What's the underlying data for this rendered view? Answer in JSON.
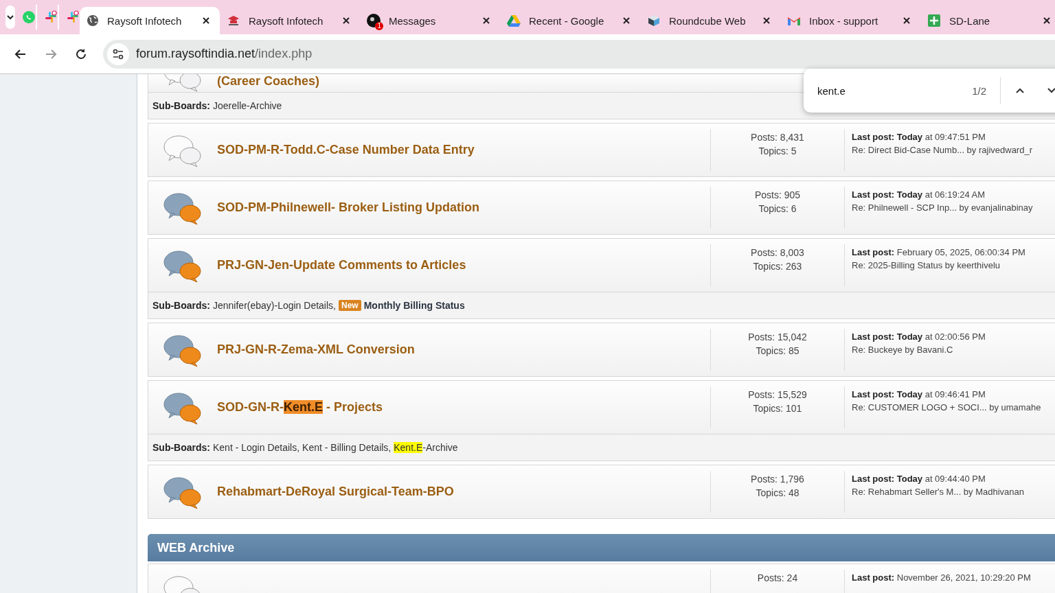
{
  "tabs": [
    {
      "kind": "pinned",
      "selected": false
    },
    {
      "kind": "pinned",
      "selected": false
    },
    {
      "kind": "pinned",
      "selected": false
    },
    {
      "kind": "tab",
      "title": "Raysoft Infotech",
      "selected": true
    },
    {
      "kind": "tab",
      "title": "Raysoft Infotech",
      "selected": false
    },
    {
      "kind": "tab",
      "title": "Messages",
      "badge": "1",
      "selected": false
    },
    {
      "kind": "tab",
      "title": "Recent - Google",
      "selected": false
    },
    {
      "kind": "tab",
      "title": "Roundcube Web",
      "selected": false
    },
    {
      "kind": "tab",
      "title": "Inbox - support",
      "selected": false
    },
    {
      "kind": "tab",
      "title": "SD-Lane",
      "selected": false
    }
  ],
  "address": {
    "host": "forum.raysoftindia.net",
    "path": "/index.php"
  },
  "find_bar": {
    "query": "kent.e",
    "count": "1/2"
  },
  "sections": [
    {
      "kind": "board_partial",
      "unread": false,
      "title": [
        {
          "text": "(Career Coaches)"
        }
      ]
    },
    {
      "kind": "subboards",
      "label": "Sub-Boards:",
      "items": [
        {
          "parts": [
            {
              "text": "Joerelle-Archive"
            }
          ]
        }
      ]
    },
    {
      "kind": "board",
      "unread": false,
      "title": [
        {
          "text": "SOD-PM-R-Todd.C-Case Number Data Entry"
        }
      ],
      "posts": "Posts: 8,431",
      "topics": "Topics: 5",
      "last_post": "**Last post: Today** at 09:47:51 PM",
      "last_reply": "Re: Direct Bid-Case Numb... by rajivedward_r"
    },
    {
      "kind": "board",
      "unread": true,
      "title": [
        {
          "text": "SOD-PM-Philnewell- Broker Listing Updation"
        }
      ],
      "posts": "Posts: 905",
      "topics": "Topics: 6",
      "last_post": "**Last post: Today** at 06:19:24 AM",
      "last_reply": "Re: Philnewell - SCP Inp... by evanjalinabinay"
    },
    {
      "kind": "board",
      "unread": true,
      "title": [
        {
          "text": "PRJ-GN-Jen-Update Comments to Articles"
        }
      ],
      "posts": "Posts: 8,003",
      "topics": "Topics: 263",
      "last_post": "**Last post:** February 05, 2025, 06:00:34 PM",
      "last_reply": "Re: 2025-Billing Status by keerthivelu"
    },
    {
      "kind": "subboards",
      "label": "Sub-Boards:",
      "items": [
        {
          "parts": [
            {
              "text": "Jennifer(ebay)-Login Details,"
            }
          ]
        },
        {
          "badge": "New",
          "unread": true,
          "parts": [
            {
              "text": "Monthly Billing Status"
            }
          ]
        }
      ]
    },
    {
      "kind": "board",
      "unread": true,
      "title": [
        {
          "text": "PRJ-GN-R-Zema-XML Conversion"
        }
      ],
      "posts": "Posts: 15,042",
      "topics": "Topics: 85",
      "last_post": "**Last post: Today** at 02:00:56 PM",
      "last_reply": "Re: Buckeye by Bavani.C"
    },
    {
      "kind": "board",
      "unread": true,
      "title": [
        {
          "text": "SOD-GN-R-",
          "highlighted": false
        },
        {
          "text": "Kent.E",
          "highlighted": true,
          "current": true
        },
        {
          "text": " - Projects",
          "highlighted": false
        }
      ],
      "posts": "Posts: 15,529",
      "topics": "Topics: 101",
      "last_post": "**Last post: Today** at 09:46:41 PM",
      "last_reply": "Re: CUSTOMER LOGO + SOCI... by umamahe"
    },
    {
      "kind": "subboards",
      "label": "Sub-Boards:",
      "items": [
        {
          "parts": [
            {
              "text": "Kent - Login Details,"
            }
          ]
        },
        {
          "parts": [
            {
              "text": "Kent - Billing Details,"
            }
          ]
        },
        {
          "parts": [
            {
              "text": "Kent.E",
              "highlighted": true,
              "current": false
            },
            {
              "text": "-Archive",
              "highlighted": false
            }
          ]
        }
      ]
    },
    {
      "kind": "board",
      "unread": true,
      "title": [
        {
          "text": "Rehabmart-DeRoyal Surgical-Team-BPO"
        }
      ],
      "posts": "Posts: 1,796",
      "topics": "Topics: 48",
      "last_post": "**Last post: Today** at 09:44:40 PM",
      "last_reply": "Re: Rehabmart Seller's M... by Madhivanan"
    },
    {
      "kind": "category",
      "title": "WEB Archive"
    },
    {
      "kind": "board",
      "unread": false,
      "posts": "Posts: 24",
      "last_post": "**Last post:** November 26, 2021, 10:29:20 PM"
    }
  ]
}
